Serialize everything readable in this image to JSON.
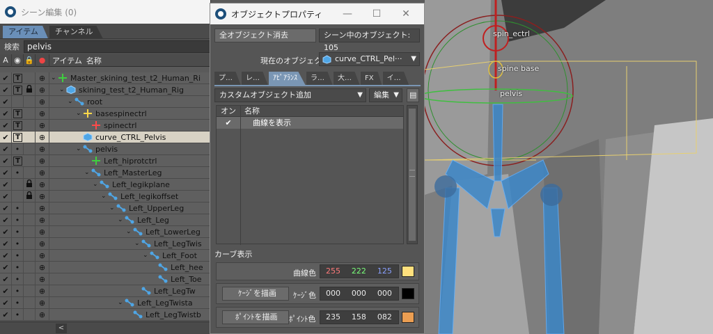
{
  "scene_editor": {
    "title": "シーン編集 (0)",
    "tabs": [
      "アイテム",
      "チャンネル"
    ],
    "search_label": "検索",
    "search_value": "pelvis",
    "columns": [
      "A",
      "アイテム",
      "名称"
    ],
    "rows": [
      {
        "name": "Master_skining_test_t2_Human_Ri",
        "icon": "locator-icon",
        "c3": "T",
        "c4": "",
        "indent": 0
      },
      {
        "name": "skining_test_t2_Human_Rig",
        "icon": "mesh-icon",
        "c3": "T",
        "c4": "lock",
        "indent": 1
      },
      {
        "name": "root",
        "icon": "joint-icon",
        "c3": "",
        "c4": "",
        "indent": 2
      },
      {
        "name": "basespinectrl",
        "icon": "locator-yellow-icon",
        "c3": "T",
        "c4": "",
        "indent": 3
      },
      {
        "name": "spinectrl",
        "icon": "locator-red-icon",
        "c3": "T",
        "c4": "",
        "indent": 4,
        "nochev": true
      },
      {
        "name": "curve_CTRL_Pelvis",
        "icon": "mesh-icon",
        "c3": "T",
        "c4": "",
        "indent": 3,
        "nochev": true,
        "sel": true
      },
      {
        "name": "pelvis",
        "icon": "joint-icon",
        "c3": "•",
        "c4": "",
        "indent": 3
      },
      {
        "name": "Left_hiprotctrl",
        "icon": "locator-green-icon",
        "c3": "T",
        "c4": "",
        "indent": 4,
        "nochev": true
      },
      {
        "name": "Left_MasterLeg",
        "icon": "joint-icon",
        "c3": "•",
        "c4": "",
        "indent": 4
      },
      {
        "name": "Left_legikplane",
        "icon": "joint-icon",
        "c3": "",
        "c4": "lock",
        "indent": 5
      },
      {
        "name": "Left_legikoffset",
        "icon": "joint-icon",
        "c3": "",
        "c4": "lock",
        "indent": 6
      },
      {
        "name": "Left_UpperLeg",
        "icon": "joint-icon",
        "c3": "•",
        "c4": "",
        "indent": 7
      },
      {
        "name": "Left_Leg",
        "icon": "joint-icon",
        "c3": "•",
        "c4": "",
        "indent": 8
      },
      {
        "name": "Left_LowerLeg",
        "icon": "joint-icon",
        "c3": "•",
        "c4": "",
        "indent": 9
      },
      {
        "name": "Left_LegTwis",
        "icon": "joint-icon",
        "c3": "•",
        "c4": "",
        "indent": 10
      },
      {
        "name": "Left_Foot",
        "icon": "joint-icon",
        "c3": "•",
        "c4": "",
        "indent": 11
      },
      {
        "name": "Left_hee",
        "icon": "joint-icon",
        "c3": "•",
        "c4": "",
        "indent": 12,
        "nochev": true
      },
      {
        "name": "Left_Toe",
        "icon": "joint-icon",
        "c3": "•",
        "c4": "",
        "indent": 12,
        "nochev": true
      },
      {
        "name": "Left_LegTw",
        "icon": "joint-icon",
        "c3": "•",
        "c4": "",
        "indent": 10,
        "nochev": true
      },
      {
        "name": "Left_LegTwista",
        "icon": "joint-icon",
        "c3": "•",
        "c4": "",
        "indent": 8
      },
      {
        "name": "Left_LegTwistb",
        "icon": "joint-icon",
        "c3": "•",
        "c4": "",
        "indent": 9,
        "nochev": true
      }
    ],
    "scroll_left": "<"
  },
  "props": {
    "title": "オブジェクトプロパティ",
    "clear_all": "全オブジェクト消去",
    "object_count": "シーン中のオブジェクト: 105",
    "current_label": "現在のオブジェクト",
    "current_value": "curve_CTRL_Pel···",
    "tabs": [
      "プ…",
      "レ…",
      "ｱﾋﾟｱﾗﾝｽ",
      "ラ…",
      "大…",
      "FX",
      "イ…"
    ],
    "add_custom": "カスタムオブジェクト追加",
    "edit": "編集",
    "list_headers": [
      "オン",
      "名称"
    ],
    "list_rows": [
      {
        "on": "✔",
        "name": "曲線を表示"
      }
    ],
    "curve_section": "カーブ表示",
    "curve_color_label": "曲線色",
    "curve_color": {
      "r": "255",
      "g": "222",
      "b": "125",
      "hex": "#ffe07d"
    },
    "cage_button": "ｹｰｼﾞを描画",
    "cage_color_label": "ｹｰｼﾞ色",
    "cage_color": {
      "r": "000",
      "g": "000",
      "b": "000",
      "hex": "#000000"
    },
    "point_button": "ﾎﾟｲﾝﾄを描画",
    "point_color_label": "ﾎﾟｲﾝﾄ色",
    "point_color": {
      "r": "235",
      "g": "158",
      "b": "082",
      "hex": "#eb9e52"
    }
  },
  "viewport": {
    "labels": [
      "spin_ectrl",
      "spine base",
      "pelvis"
    ]
  }
}
